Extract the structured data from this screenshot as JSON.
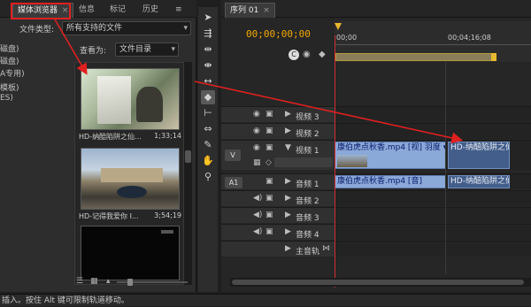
{
  "left_panel": {
    "tabs": [
      {
        "label": "媒体浏览器",
        "close": "×"
      },
      {
        "label": "信息"
      },
      {
        "label": "标记"
      },
      {
        "label": "历史"
      }
    ],
    "menu_icon": "≡",
    "filetype_label": "文件类型:",
    "filetype_value": "所有支持的文件",
    "view_as_label": "查看为:",
    "view_as_value": "文件目录",
    "tree_items": [
      "磁盘)",
      "磁盘)",
      "A专用)",
      "模板)",
      "ES)"
    ],
    "items": [
      {
        "name": "HD-纳醅陷阱之仙...",
        "duration": "1;33;14"
      },
      {
        "name": "HD-记得我爱你 I...",
        "duration": "3;54;19"
      }
    ]
  },
  "tools": [
    "selection-tool",
    "track-select-tool",
    "ripple-edit-tool",
    "rolling-edit-tool",
    "rate-stretch-tool",
    "razor-tool",
    "slip-tool",
    "slide-tool",
    "pen-tool",
    "hand-tool",
    "zoom-tool"
  ],
  "timeline": {
    "tab_label": "序列 01",
    "tab_close": "×",
    "timecode": "00;00;00;00",
    "ruler_labels": [
      "00;00",
      "00;04;16;08"
    ],
    "video_tracks": [
      {
        "name": "视频 3"
      },
      {
        "name": "视频 2"
      },
      {
        "name": "视频 1",
        "target": "V"
      }
    ],
    "audio_tracks": [
      {
        "name": "音频 1",
        "target": "A1"
      },
      {
        "name": "音频 2"
      },
      {
        "name": "音频 3"
      },
      {
        "name": "音频 4"
      },
      {
        "name": "主音轨"
      }
    ],
    "video_clip_label": "康伯虎点秋香.mp4 [视] 羽度 ▾",
    "audio_clip_label": "康伯虎点秋香.mp4 [音]",
    "drop_clip_label": "HD-纳醅陷阱之仙"
  },
  "status_text": "插入。按住 Alt 键可限制轨道移动。",
  "colors": {
    "accent_timecode": "#f2a900",
    "annotation": "#e02020",
    "clip_blue": "#8aa8d8"
  }
}
